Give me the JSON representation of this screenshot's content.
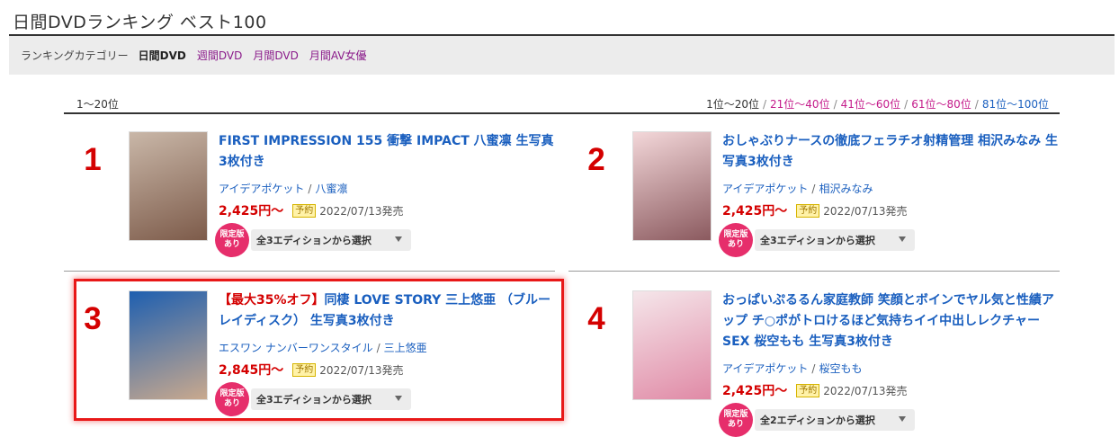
{
  "page": {
    "title": "日間DVDランキング ベスト100"
  },
  "category_bar": {
    "label": "ランキングカテゴリー",
    "current": "日間DVD",
    "links": [
      "週間DVD",
      "月間DVD",
      "月間AV女優"
    ]
  },
  "range": {
    "current": "1〜20位",
    "pager_current": "1位〜20位",
    "pager_links": [
      "21位〜40位",
      "41位〜60位",
      "61位〜80位",
      "81位〜100位"
    ]
  },
  "items": [
    {
      "rank": "1",
      "title_sale": "",
      "title": "FIRST IMPRESSION 155 衝撃 IMPACT 八蜜凛 生写真3枚付き",
      "maker": "アイデアポケット",
      "actress": "八蜜凛",
      "price": "2,425円〜",
      "status": "予約",
      "date": "2022/07/13発売",
      "badge": "限定版あり",
      "edition": "全3エディションから選択",
      "cover_colors": [
        "#c9b7a8",
        "#7d5b4a"
      ]
    },
    {
      "rank": "2",
      "title_sale": "",
      "title": "おしゃぶりナースの徹底フェラチオ射精管理 相沢みなみ 生写真3枚付き",
      "maker": "アイデアポケット",
      "actress": "相沢みなみ",
      "price": "2,425円〜",
      "status": "予約",
      "date": "2022/07/13発売",
      "badge": "限定版あり",
      "edition": "全3エディションから選択",
      "cover_colors": [
        "#f3d7d9",
        "#8b5a5f"
      ]
    },
    {
      "rank": "3",
      "title_sale": "【最大35%オフ】",
      "title": "同棲 LOVE STORY 三上悠亜 （ブルーレイディスク） 生写真3枚付き",
      "maker": "エスワン ナンバーワンスタイル",
      "actress": "三上悠亜",
      "price": "2,845円〜",
      "status": "予約",
      "date": "2022/07/13発売",
      "badge": "限定版あり",
      "edition": "全3エディションから選択",
      "cover_colors": [
        "#1e5fb0",
        "#c9a98e"
      ]
    },
    {
      "rank": "4",
      "title_sale": "",
      "title": "おっぱいぷるるん家庭教師 笑顔とボインでヤル気と性績アップ チ○ポがトロけるほど気持ちイイ中出しレクチャーSEX 桜空もも 生写真3枚付き",
      "maker": "アイデアポケット",
      "actress": "桜空もも",
      "price": "2,425円〜",
      "status": "予約",
      "date": "2022/07/13発売",
      "badge": "限定版あり",
      "edition": "全2エディションから選択",
      "cover_colors": [
        "#f5e6ea",
        "#e08aa6"
      ]
    }
  ],
  "colors": {
    "link": "#1a5fbf",
    "price": "#d40000",
    "badge": "#e62e6b",
    "category": "#8a1a8a",
    "pager": "#c41a8a"
  }
}
